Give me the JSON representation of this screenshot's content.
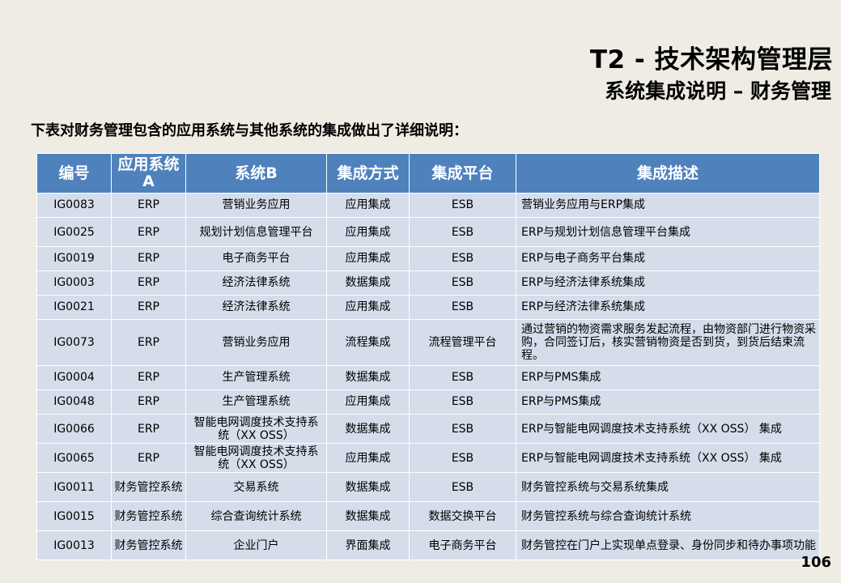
{
  "header": {
    "title": "T2 - 技术架构管理层",
    "subtitle": "系统集成说明 – 财务管理"
  },
  "intro": "下表对财务管理包含的应用系统与其他系统的集成做出了详细说明：",
  "table": {
    "columns": [
      "编号",
      "应用系统A",
      "系统B",
      "集成方式",
      "集成平台",
      "集成描述"
    ],
    "rows": [
      {
        "id": "IG0083",
        "a": "ERP",
        "b": "营销业务应用",
        "method": "应用集成",
        "platform": "ESB",
        "desc": "营销业务应用与ERP集成"
      },
      {
        "id": "IG0025",
        "a": "ERP",
        "b": "规划计划信息管理平台",
        "method": "应用集成",
        "platform": "ESB",
        "desc": "ERP与规划计划信息管理平台集成"
      },
      {
        "id": "IG0019",
        "a": "ERP",
        "b": "电子商务平台",
        "method": "应用集成",
        "platform": "ESB",
        "desc": "ERP与电子商务平台集成"
      },
      {
        "id": "IG0003",
        "a": "ERP",
        "b": "经济法律系统",
        "method": "数据集成",
        "platform": "ESB",
        "desc": "ERP与经济法律系统集成"
      },
      {
        "id": "IG0021",
        "a": "ERP",
        "b": "经济法律系统",
        "method": "应用集成",
        "platform": "ESB",
        "desc": "ERP与经济法律系统集成"
      },
      {
        "id": "IG0073",
        "a": "ERP",
        "b": "营销业务应用",
        "method": "流程集成",
        "platform": "流程管理平台",
        "desc": "通过营销的物资需求服务发起流程，由物资部门进行物资采购，合同签订后，核实营销物资是否到货，到货后结束流程。"
      },
      {
        "id": "IG0004",
        "a": "ERP",
        "b": "生产管理系统",
        "method": "数据集成",
        "platform": "ESB",
        "desc": "ERP与PMS集成"
      },
      {
        "id": "IG0048",
        "a": "ERP",
        "b": "生产管理系统",
        "method": "应用集成",
        "platform": "ESB",
        "desc": "ERP与PMS集成"
      },
      {
        "id": "IG0066",
        "a": "ERP",
        "b": "智能电网调度技术支持系统（XX OSS）",
        "method": "数据集成",
        "platform": "ESB",
        "desc": "ERP与智能电网调度技术支持系统（XX OSS） 集成"
      },
      {
        "id": "IG0065",
        "a": "ERP",
        "b": "智能电网调度技术支持系统（XX OSS）",
        "method": "应用集成",
        "platform": "ESB",
        "desc": "ERP与智能电网调度技术支持系统（XX OSS） 集成"
      },
      {
        "id": "IG0011",
        "a": "财务管控系统",
        "b": "交易系统",
        "method": "数据集成",
        "platform": "ESB",
        "desc": "财务管控系统与交易系统集成"
      },
      {
        "id": "IG0015",
        "a": "财务管控系统",
        "b": "综合查询统计系统",
        "method": "数据集成",
        "platform": "数据交换平台",
        "desc": "财务管控系统与综合查询统计系统"
      },
      {
        "id": "IG0013",
        "a": "财务管控系统",
        "b": "企业门户",
        "method": "界面集成",
        "platform": "电子商务平台",
        "desc": "财务管控在门户上实现单点登录、身份同步和待办事项功能"
      }
    ]
  },
  "page_number": "106"
}
